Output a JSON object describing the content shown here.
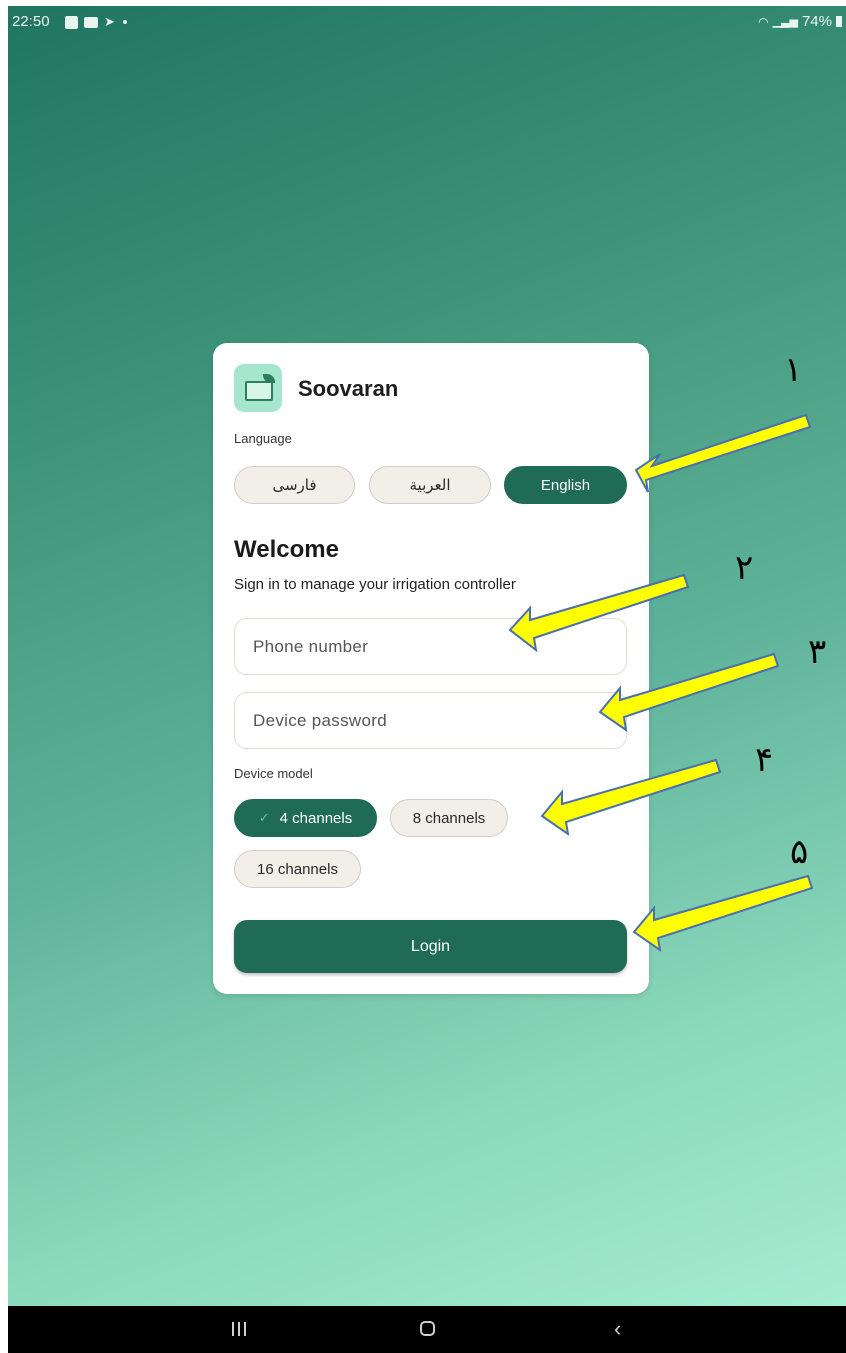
{
  "status_bar": {
    "time": "22:50",
    "battery": "74%"
  },
  "app": {
    "name": "Soovaran"
  },
  "language": {
    "label": "Language",
    "options": [
      "فارسی",
      "العربية",
      "English"
    ],
    "selected": "English"
  },
  "welcome": {
    "title": "Welcome",
    "subtitle": "Sign in to manage your irrigation controller"
  },
  "form": {
    "phone_placeholder": "Phone number",
    "password_placeholder": "Device password",
    "device_model_label": "Device model",
    "device_models": [
      "4 channels",
      "8 channels",
      "16 channels"
    ],
    "selected_model": "4 channels",
    "login_label": "Login"
  },
  "annotations": {
    "markers": [
      "١",
      "٢",
      "٣",
      "۴",
      "۵"
    ],
    "arrow_color": "#ffff00"
  },
  "colors": {
    "accent": "#1f6b55",
    "logo_bg": "#a6e6cf"
  }
}
